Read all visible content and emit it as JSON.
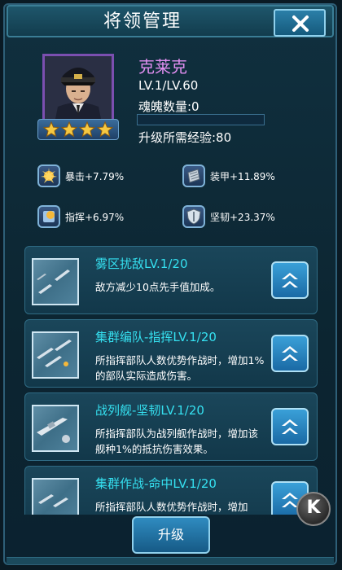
{
  "header": {
    "title": "将领管理",
    "close_label": "✕"
  },
  "hero": {
    "name": "克莱克",
    "level": "LV.1/LV.60",
    "soul_label": "魂魄数量:0",
    "soul_progress": 0,
    "exp_label": "升级所需经验:80",
    "stars": 4
  },
  "stats": [
    {
      "icon": "crit-icon",
      "label": "暴击+7.79%"
    },
    {
      "icon": "armor-icon",
      "label": "装甲+11.89%"
    },
    {
      "icon": "command-icon",
      "label": "指挥+6.97%"
    },
    {
      "icon": "toughness-icon",
      "label": "坚韧+23.37%"
    }
  ],
  "skills": [
    {
      "name": "雾区扰敌LV.1/20",
      "desc": "敌方减少10点先手值加成。"
    },
    {
      "name": "集群编队-指挥LV.1/20",
      "desc": "所指挥部队人数优势作战时，增加1%的部队实际造成伤害。"
    },
    {
      "name": "战列舰-坚韧LV.1/20",
      "desc": "所指挥部队为战列舰作战时，增加该舰种1%的抵抗伤害效果。"
    },
    {
      "name": "集群作战-命中LV.1/20",
      "desc": "所指挥部队人数优势作战时，增加"
    }
  ],
  "footer": {
    "upgrade_label": "升级"
  },
  "logo": {
    "letter": "K"
  },
  "colors": {
    "accent": "#35e0f0",
    "hero_name": "#e08ef0",
    "frame": "#2e5f78"
  }
}
